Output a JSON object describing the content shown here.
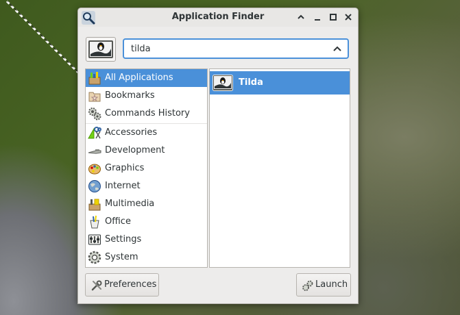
{
  "window": {
    "title": "Application Finder",
    "controls": [
      "chevron-up-icon",
      "minimize-icon",
      "maximize-icon",
      "close-icon"
    ]
  },
  "search": {
    "value": "tilda"
  },
  "categories": [
    {
      "label": "All Applications",
      "icon": "all-applications-icon",
      "selected": true
    },
    {
      "label": "Bookmarks",
      "icon": "bookmarks-icon"
    },
    {
      "label": "Commands History",
      "icon": "commands-history-icon"
    },
    {
      "label": "Accessories",
      "icon": "accessories-icon"
    },
    {
      "label": "Development",
      "icon": "development-icon"
    },
    {
      "label": "Graphics",
      "icon": "graphics-icon"
    },
    {
      "label": "Internet",
      "icon": "internet-icon"
    },
    {
      "label": "Multimedia",
      "icon": "multimedia-icon"
    },
    {
      "label": "Office",
      "icon": "office-icon"
    },
    {
      "label": "Settings",
      "icon": "settings-icon"
    },
    {
      "label": "System",
      "icon": "system-icon"
    }
  ],
  "results": [
    {
      "label": "Tilda",
      "icon": "tilda-terminal-icon",
      "selected": true
    }
  ],
  "buttons": {
    "preferences": "Preferences",
    "launch": "Launch"
  },
  "colors": {
    "selection": "#4a90d9",
    "window_bg": "#edeceb"
  }
}
